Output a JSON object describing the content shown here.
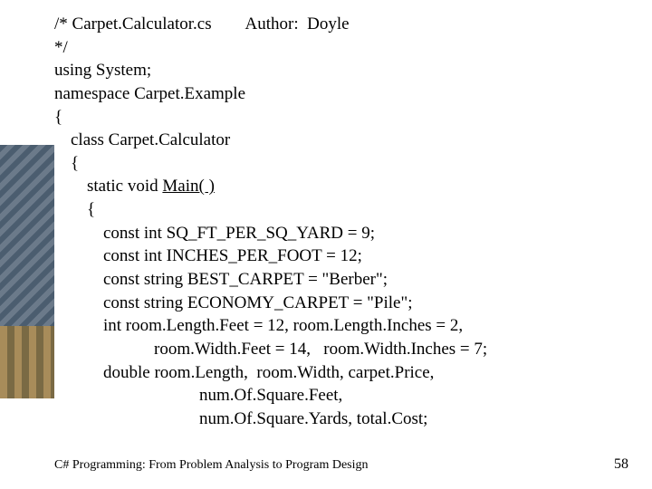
{
  "code": {
    "l1a": "/* Carpet.Calculator.cs",
    "l1b": "Author:  Doyle",
    "l2": "*/",
    "l3": "using System;",
    "l4": "namespace Carpet.Example",
    "l5": "{",
    "l6": "class Carpet.Calculator",
    "l7": "{",
    "l8a": "static void ",
    "l8b": "Main( )",
    "l9": "{",
    "l10": "const int SQ_FT_PER_SQ_YARD = 9;",
    "l11": "const int INCHES_PER_FOOT = 12;",
    "l12": "const string BEST_CARPET = \"Berber\";",
    "l13": "const string ECONOMY_CARPET = \"Pile\";",
    "l14": "int room.Length.Feet = 12, room.Length.Inches = 2,",
    "l15": "room.Width.Feet = 14,   room.Width.Inches = 7;",
    "l16": "double room.Length,  room.Width, carpet.Price,",
    "l17": "num.Of.Square.Feet,",
    "l18": "num.Of.Square.Yards, total.Cost;"
  },
  "footer": "C# Programming: From Problem Analysis to Program Design",
  "page": "58"
}
